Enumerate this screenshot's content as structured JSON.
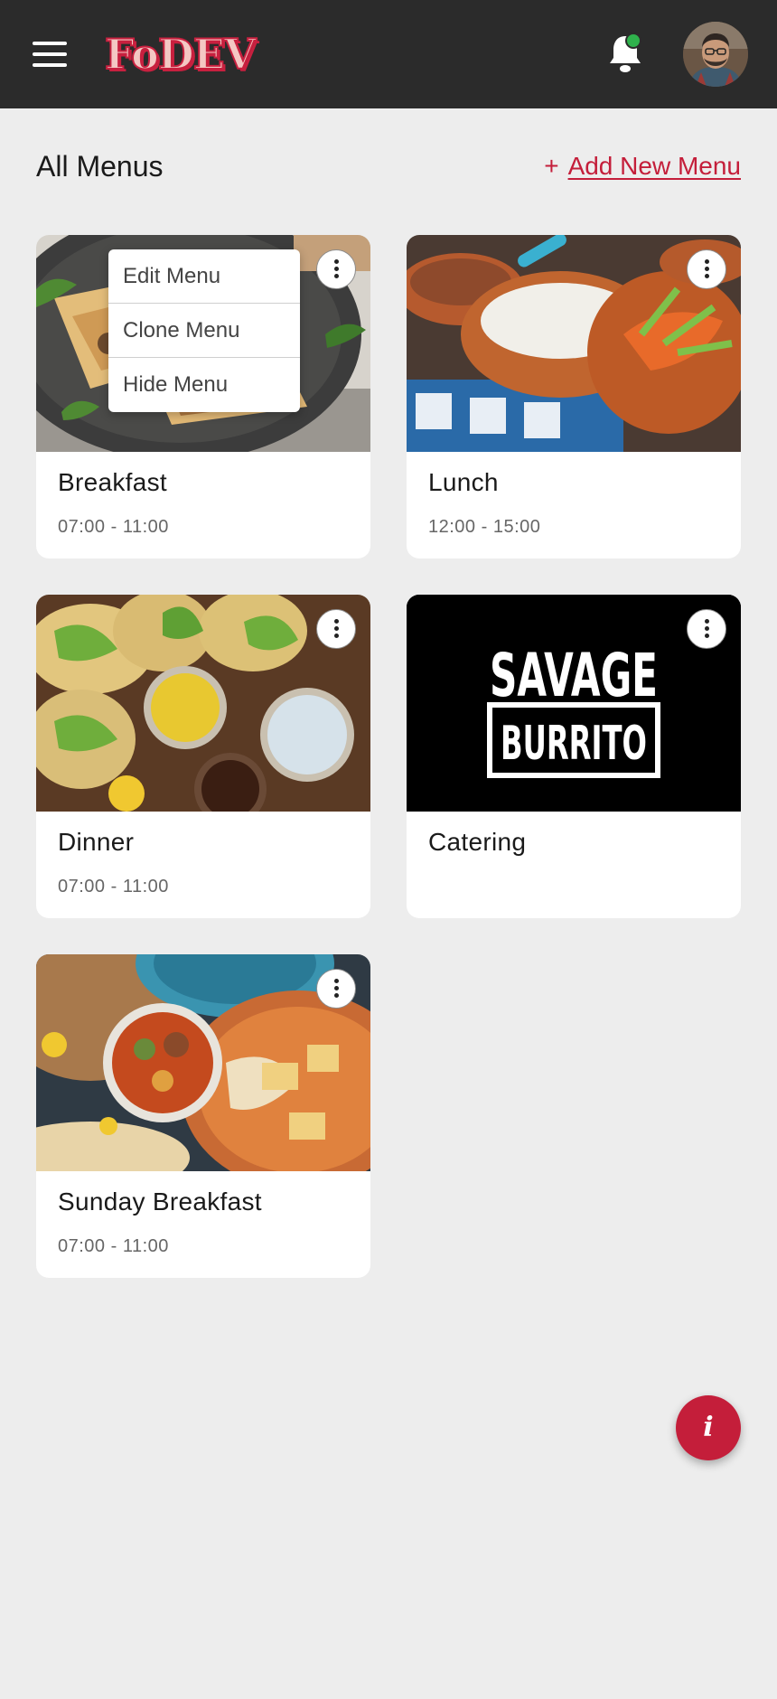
{
  "header": {
    "logo_text": "FoDEV",
    "notification_badge_color": "#2fb24c"
  },
  "page": {
    "title": "All Menus",
    "add_prefix": "+",
    "add_label": "Add New Menu",
    "accent_color": "#c41e3a"
  },
  "menus": [
    {
      "name": "Breakfast",
      "time": "07:00 - 11:00"
    },
    {
      "name": "Lunch",
      "time": "12:00 - 15:00"
    },
    {
      "name": "Dinner",
      "time": "07:00 - 11:00"
    },
    {
      "name": "Catering",
      "time": "",
      "logo_line1": "SAVAGE",
      "logo_line2": "BURRITO"
    },
    {
      "name": "Sunday Breakfast",
      "time": "07:00 - 11:00"
    }
  ],
  "context_menu": {
    "items": [
      "Edit Menu",
      "Clone Menu",
      "Hide Menu"
    ]
  },
  "fab": {
    "label": "i"
  }
}
